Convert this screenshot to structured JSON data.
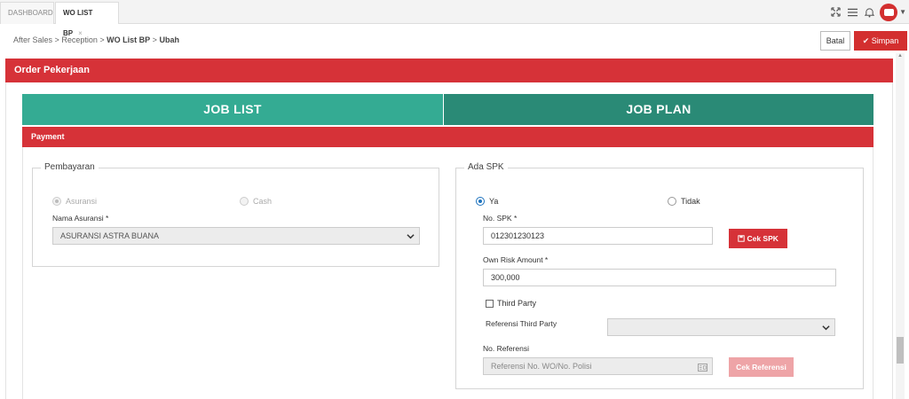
{
  "tabs": [
    {
      "label": "DASHBOARD"
    },
    {
      "label": "WO LIST BP",
      "close": "×"
    }
  ],
  "topbar": {
    "icons": [
      "expand-icon",
      "menu-icon",
      "bell-icon",
      "user-avatar-icon",
      "chevron-down-icon"
    ]
  },
  "breadcrumb": {
    "items": [
      "After Sales",
      "Reception",
      "WO List BP",
      "Ubah"
    ],
    "separator": ">"
  },
  "actions": {
    "cancel": "Batal",
    "save": "Simpan",
    "save_icon": "✔"
  },
  "section_title": "Order Pekerjaan",
  "job_tabs": {
    "list": "JOB LIST",
    "plan": "JOB PLAN"
  },
  "payment_header": "Payment",
  "pembayaran": {
    "legend": "Pembayaran",
    "options": [
      "Asuransi",
      "Cash"
    ],
    "selected": "Asuransi",
    "insurance_label": "Nama Asuransi *",
    "insurance_value": "ASURANSI ASTRA BUANA"
  },
  "spk": {
    "legend": "Ada SPK",
    "options": [
      "Ya",
      "Tidak"
    ],
    "selected": "Ya",
    "no_spk_label": "No. SPK *",
    "no_spk_value": "012301230123",
    "cek_spk": "Cek SPK",
    "own_risk_label": "Own Risk Amount *",
    "own_risk_value": "300,000",
    "third_party_label": "Third Party",
    "ref_third_party_label": "Referensi Third Party",
    "no_ref_label": "No. Referensi",
    "no_ref_placeholder": "Referensi No. WO/No. Polisi",
    "cek_referensi": "Cek Referensi"
  },
  "colors": {
    "primary_red": "#d63238",
    "teal": "#34ab93",
    "teal_dark": "#2a8a76",
    "radio_blue": "#1e73be"
  }
}
